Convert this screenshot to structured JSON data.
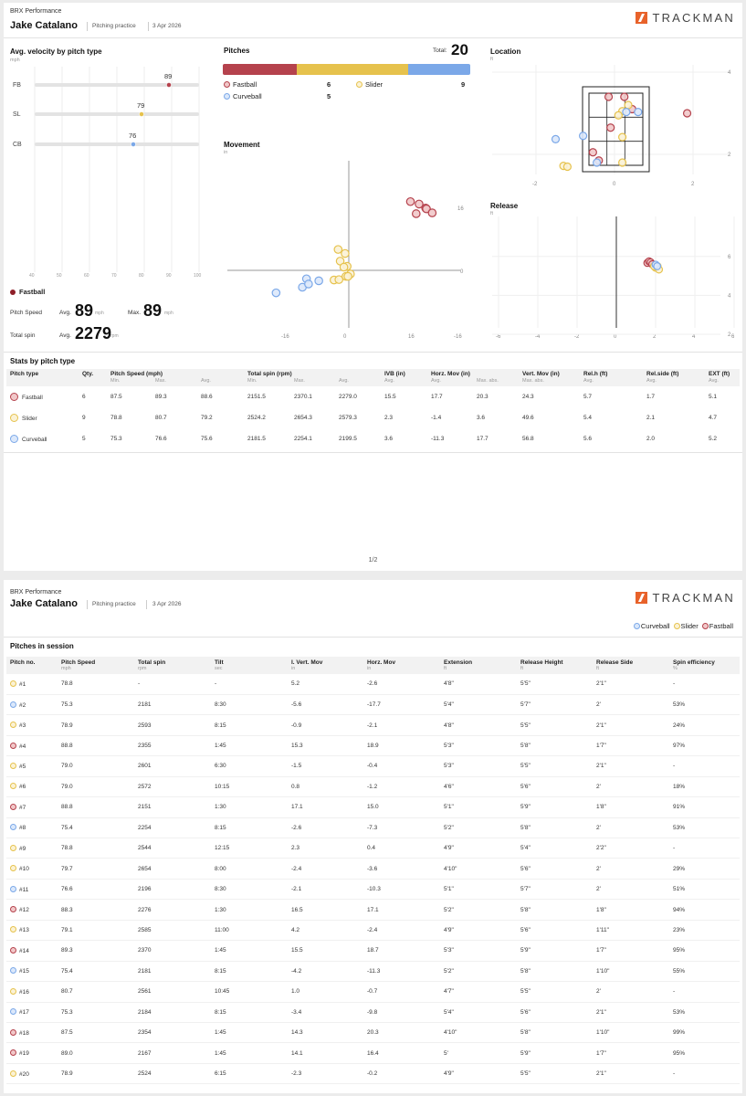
{
  "report": {
    "org": "BRX Performance",
    "player": "Jake Catalano",
    "session_type": "Pitching practice",
    "date": "3 Apr 2026",
    "brand": "TRACKMAN",
    "page_indicator": "1/2"
  },
  "colors": {
    "fastball": "#b5424d",
    "slider": "#e6c24d",
    "curveball": "#7ba8e8",
    "fastball_fill": "#f1c8c9",
    "slider_fill": "#fbf2d5",
    "curveball_fill": "#dbe8fb"
  },
  "velocity": {
    "title": "Avg. velocity by pitch type",
    "unit": "mph",
    "rows": [
      {
        "label": "FB",
        "value": 89,
        "value_text": "89",
        "type": "fastball"
      },
      {
        "label": "SL",
        "value": 79,
        "value_text": "79",
        "type": "slider"
      },
      {
        "label": "CB",
        "value": 76,
        "value_text": "76",
        "type": "curveball"
      }
    ],
    "axis_ticks": [
      "40",
      "50",
      "60",
      "70",
      "80",
      "90",
      "100"
    ],
    "legend": "Fastball",
    "speed_label": "Pitch Speed",
    "avg_label": "Avg.",
    "max_label": "Max.",
    "avg_speed": "89",
    "max_speed": "89",
    "speed_unit": "mph",
    "spin_label": "Total spin",
    "avg_spin": "2279",
    "spin_unit": "rpm"
  },
  "pitches": {
    "title": "Pitches",
    "total_label": "Total:",
    "total": "20",
    "legend": [
      {
        "name": "Fastball",
        "count": "6",
        "type": "fastball"
      },
      {
        "name": "Slider",
        "count": "9",
        "type": "slider"
      },
      {
        "name": "Curveball",
        "count": "5",
        "type": "curveball"
      }
    ]
  },
  "location": {
    "title": "Location",
    "unit": "ft",
    "x_ticks": [
      "-2",
      "0",
      "2"
    ],
    "y_ticks": [
      "4",
      "2"
    ]
  },
  "movement": {
    "title": "Movement",
    "unit": "in",
    "x_ticks": [
      "-16",
      "0",
      "16",
      "-16"
    ],
    "y_ticks": [
      "16",
      "0"
    ]
  },
  "release": {
    "title": "Release",
    "unit": "ft",
    "x_ticks": [
      "-6",
      "-4",
      "-2",
      "0",
      "2",
      "4",
      "6"
    ],
    "y_ticks": [
      "6",
      "4",
      "2"
    ]
  },
  "stats": {
    "title": "Stats by pitch type",
    "headers": {
      "type": "Pitch type",
      "qty": "Qty.",
      "speed": "Pitch Speed (mph)",
      "spin": "Total spin (rpm)",
      "ivb": "IVB (in)",
      "horz": "Horz. Mov (in)",
      "vert": "Vert. Mov (in)",
      "relh": "Rel.h (ft)",
      "rels": "Rel.side (ft)",
      "ext": "EXT (ft)"
    },
    "sub": {
      "min": "Min.",
      "max": "Max.",
      "avg": "Avg.",
      "max_abs": "Max. abs."
    },
    "rows": [
      {
        "type": "fastball",
        "name": "Fastball",
        "qty": "6",
        "smin": "87.5",
        "smax": "89.3",
        "savg": "88.6",
        "spmin": "2151.5",
        "spmax": "2370.1",
        "spavg": "2279.0",
        "ivb": "15.5",
        "havg": "17.7",
        "hmax": "20.3",
        "vert": "24.3",
        "relh": "5.7",
        "rels": "1.7",
        "ext": "5.1"
      },
      {
        "type": "slider",
        "name": "Slider",
        "qty": "9",
        "smin": "78.8",
        "smax": "80.7",
        "savg": "79.2",
        "spmin": "2524.2",
        "spmax": "2654.3",
        "spavg": "2579.3",
        "ivb": "2.3",
        "havg": "-1.4",
        "hmax": "3.6",
        "vert": "49.6",
        "relh": "5.4",
        "rels": "2.1",
        "ext": "4.7"
      },
      {
        "type": "curveball",
        "name": "Curveball",
        "qty": "5",
        "smin": "75.3",
        "smax": "76.6",
        "savg": "75.6",
        "spmin": "2181.5",
        "spmax": "2254.1",
        "spavg": "2199.5",
        "ivb": "3.6",
        "havg": "-11.3",
        "hmax": "17.7",
        "vert": "56.8",
        "relh": "5.6",
        "rels": "2.0",
        "ext": "5.2"
      }
    ]
  },
  "session": {
    "title": "Pitches in session",
    "legend": [
      "Curveball",
      "Slider",
      "Fastball"
    ],
    "headers": [
      "Pitch no.",
      "Pitch Speed",
      "Total spin",
      "Tilt",
      "I. Vert. Mov",
      "Horz. Mov",
      "Extension",
      "Release Height",
      "Release Side",
      "Spin efficiency"
    ],
    "units": [
      "",
      "mph",
      "rpm",
      "sec",
      "in",
      "in",
      "ft",
      "ft",
      "ft",
      "%"
    ],
    "rows": [
      {
        "type": "slider",
        "no": "#1",
        "speed": "78.8",
        "spin": "-",
        "tilt": "-",
        "ivm": "5.2",
        "horz": "-2.6",
        "ext": "4'8\"",
        "relh": "5'5\"",
        "rels": "2'1\"",
        "eff": "-"
      },
      {
        "type": "curveball",
        "no": "#2",
        "speed": "75.3",
        "spin": "2181",
        "tilt": "8:30",
        "ivm": "-5.6",
        "horz": "-17.7",
        "ext": "5'4\"",
        "relh": "5'7\"",
        "rels": "2'",
        "eff": "53%"
      },
      {
        "type": "slider",
        "no": "#3",
        "speed": "78.9",
        "spin": "2593",
        "tilt": "8:15",
        "ivm": "-0.9",
        "horz": "-2.1",
        "ext": "4'8\"",
        "relh": "5'5\"",
        "rels": "2'1\"",
        "eff": "24%"
      },
      {
        "type": "fastball",
        "no": "#4",
        "speed": "88.8",
        "spin": "2355",
        "tilt": "1:45",
        "ivm": "15.3",
        "horz": "18.9",
        "ext": "5'3\"",
        "relh": "5'8\"",
        "rels": "1'7\"",
        "eff": "97%"
      },
      {
        "type": "slider",
        "no": "#5",
        "speed": "79.0",
        "spin": "2601",
        "tilt": "6:30",
        "ivm": "-1.5",
        "horz": "-0.4",
        "ext": "5'3\"",
        "relh": "5'5\"",
        "rels": "2'1\"",
        "eff": "-"
      },
      {
        "type": "slider",
        "no": "#6",
        "speed": "79.0",
        "spin": "2572",
        "tilt": "10:15",
        "ivm": "0.8",
        "horz": "-1.2",
        "ext": "4'6\"",
        "relh": "5'6\"",
        "rels": "2'",
        "eff": "18%"
      },
      {
        "type": "fastball",
        "no": "#7",
        "speed": "88.8",
        "spin": "2151",
        "tilt": "1:30",
        "ivm": "17.1",
        "horz": "15.0",
        "ext": "5'1\"",
        "relh": "5'9\"",
        "rels": "1'8\"",
        "eff": "91%"
      },
      {
        "type": "curveball",
        "no": "#8",
        "speed": "75.4",
        "spin": "2254",
        "tilt": "8:15",
        "ivm": "-2.6",
        "horz": "-7.3",
        "ext": "5'2\"",
        "relh": "5'8\"",
        "rels": "2'",
        "eff": "53%"
      },
      {
        "type": "slider",
        "no": "#9",
        "speed": "78.8",
        "spin": "2544",
        "tilt": "12:15",
        "ivm": "2.3",
        "horz": "0.4",
        "ext": "4'9\"",
        "relh": "5'4\"",
        "rels": "2'2\"",
        "eff": "-"
      },
      {
        "type": "slider",
        "no": "#10",
        "speed": "79.7",
        "spin": "2654",
        "tilt": "8:00",
        "ivm": "-2.4",
        "horz": "-3.6",
        "ext": "4'10\"",
        "relh": "5'6\"",
        "rels": "2'",
        "eff": "29%"
      },
      {
        "type": "curveball",
        "no": "#11",
        "speed": "76.6",
        "spin": "2196",
        "tilt": "8:30",
        "ivm": "-2.1",
        "horz": "-10.3",
        "ext": "5'1\"",
        "relh": "5'7\"",
        "rels": "2'",
        "eff": "51%"
      },
      {
        "type": "fastball",
        "no": "#12",
        "speed": "88.3",
        "spin": "2276",
        "tilt": "1:30",
        "ivm": "16.5",
        "horz": "17.1",
        "ext": "5'2\"",
        "relh": "5'8\"",
        "rels": "1'8\"",
        "eff": "94%"
      },
      {
        "type": "slider",
        "no": "#13",
        "speed": "79.1",
        "spin": "2585",
        "tilt": "11:00",
        "ivm": "4.2",
        "horz": "-2.4",
        "ext": "4'9\"",
        "relh": "5'6\"",
        "rels": "1'11\"",
        "eff": "23%"
      },
      {
        "type": "fastball",
        "no": "#14",
        "speed": "89.3",
        "spin": "2370",
        "tilt": "1:45",
        "ivm": "15.5",
        "horz": "18.7",
        "ext": "5'3\"",
        "relh": "5'9\"",
        "rels": "1'7\"",
        "eff": "95%"
      },
      {
        "type": "curveball",
        "no": "#15",
        "speed": "75.4",
        "spin": "2181",
        "tilt": "8:15",
        "ivm": "-4.2",
        "horz": "-11.3",
        "ext": "5'2\"",
        "relh": "5'8\"",
        "rels": "1'10\"",
        "eff": "55%"
      },
      {
        "type": "slider",
        "no": "#16",
        "speed": "80.7",
        "spin": "2561",
        "tilt": "10:45",
        "ivm": "1.0",
        "horz": "-0.7",
        "ext": "4'7\"",
        "relh": "5'5\"",
        "rels": "2'",
        "eff": "-"
      },
      {
        "type": "curveball",
        "no": "#17",
        "speed": "75.3",
        "spin": "2184",
        "tilt": "8:15",
        "ivm": "-3.4",
        "horz": "-9.8",
        "ext": "5'4\"",
        "relh": "5'6\"",
        "rels": "2'1\"",
        "eff": "53%"
      },
      {
        "type": "fastball",
        "no": "#18",
        "speed": "87.5",
        "spin": "2354",
        "tilt": "1:45",
        "ivm": "14.3",
        "horz": "20.3",
        "ext": "4'10\"",
        "relh": "5'8\"",
        "rels": "1'10\"",
        "eff": "99%"
      },
      {
        "type": "fastball",
        "no": "#19",
        "speed": "89.0",
        "spin": "2167",
        "tilt": "1:45",
        "ivm": "14.1",
        "horz": "16.4",
        "ext": "5'",
        "relh": "5'9\"",
        "rels": "1'7\"",
        "eff": "95%"
      },
      {
        "type": "slider",
        "no": "#20",
        "speed": "78.9",
        "spin": "2524",
        "tilt": "6:15",
        "ivm": "-2.3",
        "horz": "-0.2",
        "ext": "4'9\"",
        "relh": "5'5\"",
        "rels": "2'1\"",
        "eff": "-"
      }
    ]
  },
  "chart_data": [
    {
      "type": "bar",
      "title": "Avg. velocity by pitch type",
      "ylabel": "mph",
      "categories": [
        "FB",
        "SL",
        "CB"
      ],
      "values": [
        89,
        79,
        76
      ],
      "xlim": [
        40,
        100
      ]
    },
    {
      "type": "bar",
      "title": "Pitches",
      "categories": [
        "Fastball",
        "Slider",
        "Curveball"
      ],
      "values": [
        6,
        9,
        5
      ]
    },
    {
      "type": "scatter",
      "title": "Location",
      "xlabel": "ft",
      "xlim": [
        -3,
        3
      ],
      "ylim": [
        1.2,
        4
      ],
      "series": [
        {
          "name": "Fastball",
          "x": [
            -0.15,
            0.25,
            0.45,
            -0.1,
            1.85,
            -0.55,
            -0.4
          ],
          "y": [
            3.4,
            3.4,
            3.1,
            2.65,
            3.0,
            2.05,
            1.85
          ]
        },
        {
          "name": "Slider",
          "x": [
            0.35,
            0.2,
            0.1,
            0.2,
            -1.3,
            -1.2,
            0.2
          ],
          "y": [
            3.2,
            3.05,
            2.95,
            2.42,
            1.72,
            1.7,
            1.8
          ]
        },
        {
          "name": "Curveball",
          "x": [
            0.3,
            0.6,
            -0.8,
            -1.5,
            -0.45
          ],
          "y": [
            3.03,
            3.03,
            2.45,
            2.37,
            1.8
          ]
        }
      ]
    },
    {
      "type": "scatter",
      "title": "Movement",
      "xlabel": "in",
      "xlim": [
        -30,
        30
      ],
      "ylim": [
        -18,
        25
      ],
      "series": [
        {
          "name": "Fastball",
          "x": [
            15.0,
            16.4,
            17.1,
            18.7,
            18.9,
            20.3
          ],
          "y": [
            17.1,
            14.1,
            16.5,
            15.5,
            15.3,
            14.3
          ]
        },
        {
          "name": "Slider",
          "x": [
            -2.6,
            -0.9,
            -2.1,
            -0.4,
            -1.2,
            0.4,
            -3.6,
            -2.4,
            -0.7,
            -0.2
          ],
          "y": [
            5.2,
            4.2,
            2.3,
            1.0,
            0.8,
            -0.9,
            -2.4,
            -2.3,
            -1.5,
            -1.5
          ]
        },
        {
          "name": "Curveball",
          "x": [
            -17.7,
            -10.3,
            -11.3,
            -9.8,
            -7.3
          ],
          "y": [
            -5.6,
            -2.1,
            -4.2,
            -3.4,
            -2.6
          ]
        }
      ]
    },
    {
      "type": "scatter",
      "title": "Release",
      "xlabel": "ft",
      "xlim": [
        -6,
        6
      ],
      "ylim": [
        2,
        7
      ],
      "series": [
        {
          "name": "Fastball",
          "x": [
            1.58,
            1.67,
            1.75,
            1.83
          ],
          "y": [
            5.67,
            5.75,
            5.7,
            5.6
          ]
        },
        {
          "name": "Slider",
          "x": [
            2.0,
            2.1,
            2.17,
            1.92
          ],
          "y": [
            5.42,
            5.5,
            5.33,
            5.5
          ]
        },
        {
          "name": "Curveball",
          "x": [
            2.0,
            2.08
          ],
          "y": [
            5.58,
            5.5
          ]
        }
      ]
    }
  ]
}
